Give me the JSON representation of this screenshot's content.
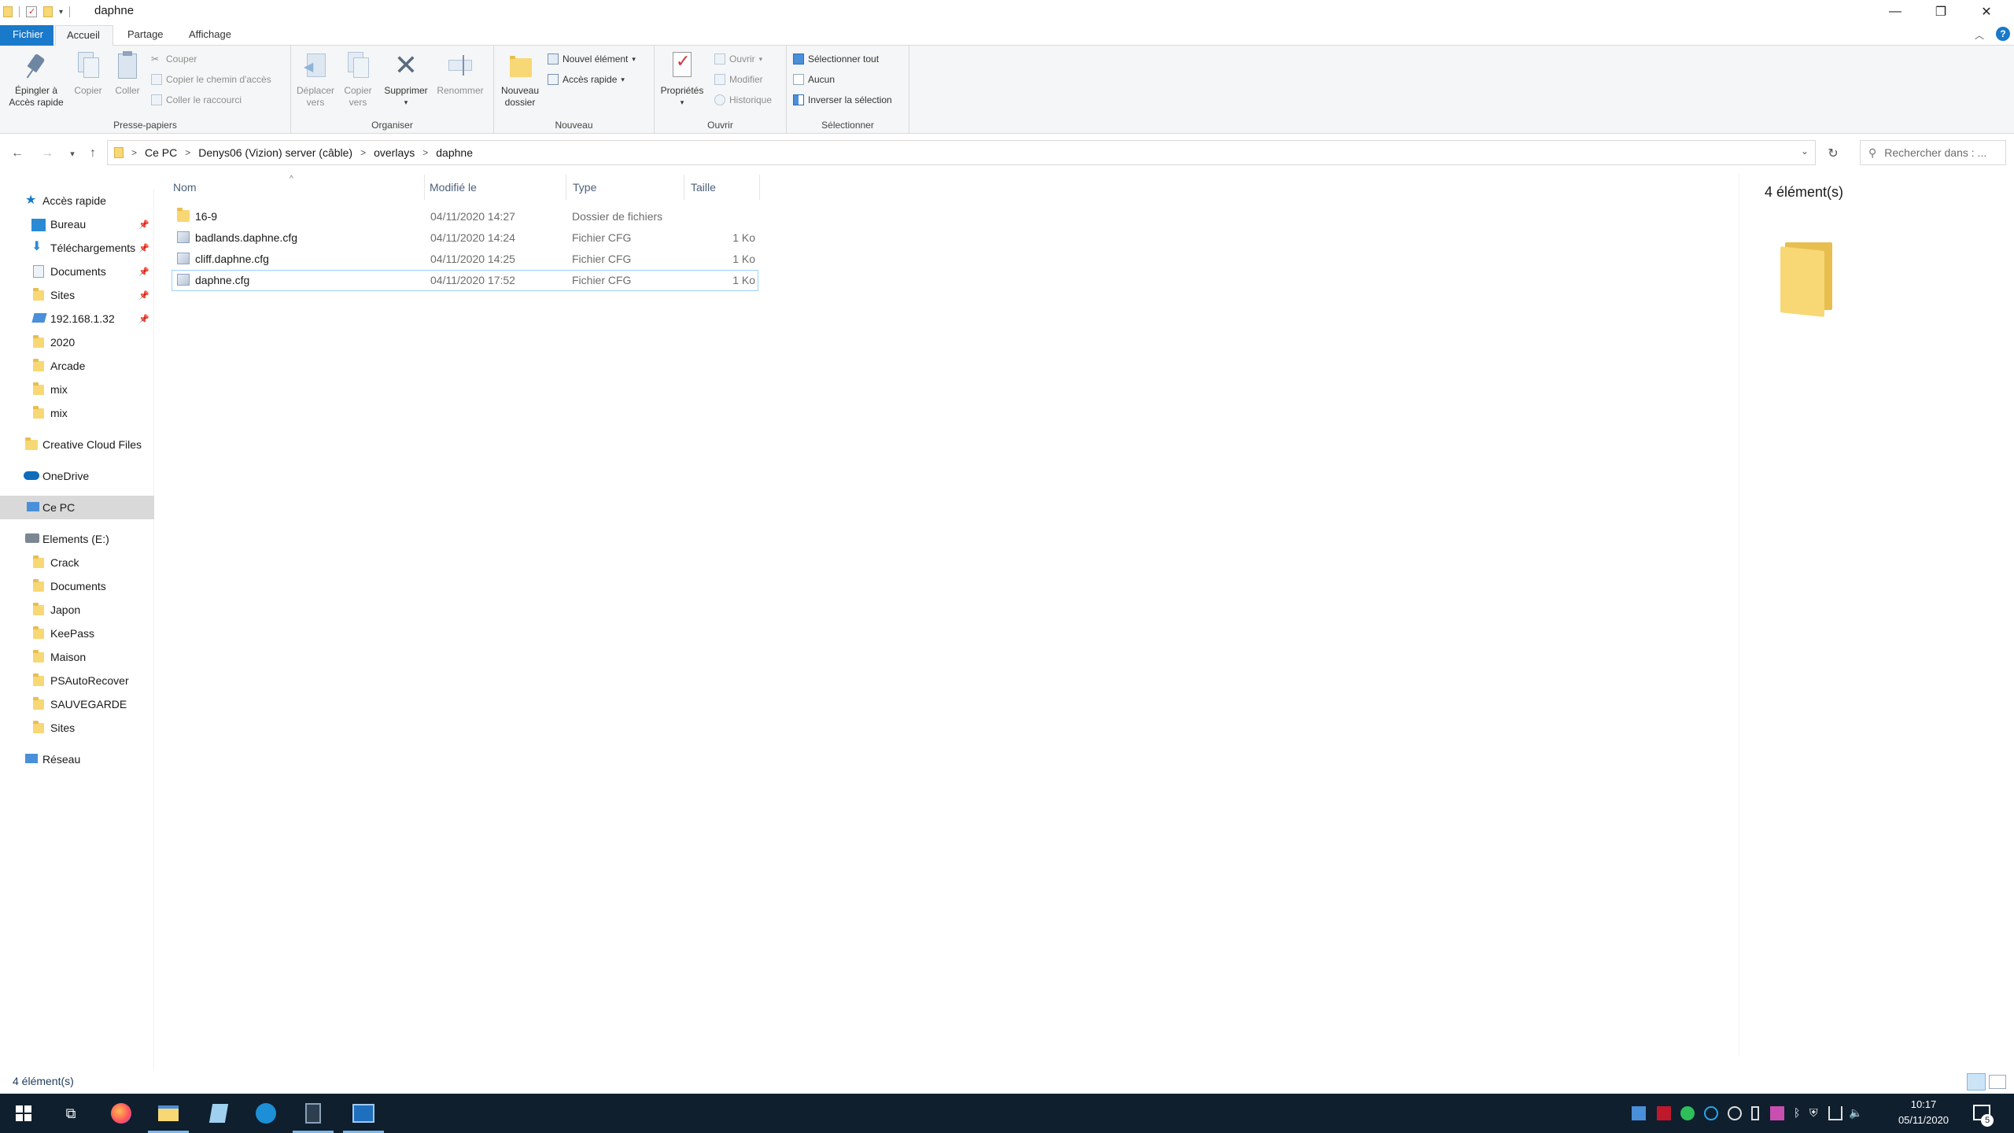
{
  "window": {
    "title": "daphne",
    "controls": {
      "minimize": "—",
      "maximize": "❐",
      "close": "✕"
    }
  },
  "ribbon_tabs": [
    "Fichier",
    "Accueil",
    "Partage",
    "Affichage"
  ],
  "ribbon": {
    "presse_papiers": {
      "label": "Presse-papiers",
      "pin_line1": "Épingler à",
      "pin_line2": "Accès rapide",
      "copier": "Copier",
      "coller": "Coller",
      "couper": "Couper",
      "copier_chemin": "Copier le chemin d'accès",
      "coller_raccourci": "Coller le raccourci"
    },
    "organiser": {
      "label": "Organiser",
      "deplacer_line1": "Déplacer",
      "deplacer_line2": "vers",
      "copier_line1": "Copier",
      "copier_line2": "vers",
      "supprimer": "Supprimer",
      "renommer": "Renommer"
    },
    "nouveau": {
      "label": "Nouveau",
      "nouveau_dossier_line1": "Nouveau",
      "nouveau_dossier_line2": "dossier",
      "nouvel_element": "Nouvel élément",
      "acces_rapide": "Accès rapide"
    },
    "ouvrir": {
      "label": "Ouvrir",
      "proprietes": "Propriétés",
      "ouvrir": "Ouvrir",
      "modifier": "Modifier",
      "historique": "Historique"
    },
    "selectionner": {
      "label": "Sélectionner",
      "tout": "Sélectionner tout",
      "aucun": "Aucun",
      "inverser": "Inverser la sélection"
    }
  },
  "address": {
    "crumbs": [
      "Ce PC",
      "Denys06 (Vizion) server (câble)",
      "overlays",
      "daphne"
    ],
    "search_placeholder": "Rechercher dans : ..."
  },
  "sidebar": {
    "quick_access": "Accès rapide",
    "quick_items": [
      "Bureau",
      "Téléchargements",
      "Documents",
      "Sites",
      "192.168.1.32",
      "2020",
      "Arcade",
      "mix",
      "mix"
    ],
    "creative_cloud": "Creative Cloud Files",
    "onedrive": "OneDrive",
    "this_pc": "Ce PC",
    "drive": "Elements (E:)",
    "drive_items": [
      "Crack",
      "Documents",
      "Japon",
      "KeePass",
      "Maison",
      "PSAutoRecover",
      "SAUVEGARDE",
      "Sites"
    ],
    "network": "Réseau"
  },
  "columns": [
    "Nom",
    "Modifié le",
    "Type",
    "Taille"
  ],
  "files": [
    {
      "name": "16-9",
      "modified": "04/11/2020 14:27",
      "type": "Dossier de fichiers",
      "size": ""
    },
    {
      "name": "badlands.daphne.cfg",
      "modified": "04/11/2020 14:24",
      "type": "Fichier CFG",
      "size": "1 Ko"
    },
    {
      "name": "cliff.daphne.cfg",
      "modified": "04/11/2020 14:25",
      "type": "Fichier CFG",
      "size": "1 Ko"
    },
    {
      "name": "daphne.cfg",
      "modified": "04/11/2020 17:52",
      "type": "Fichier CFG",
      "size": "1 Ko"
    }
  ],
  "preview": {
    "count": "4 élément(s)"
  },
  "status": {
    "count": "4 élément(s)"
  },
  "taskbar": {
    "time": "10:17",
    "date": "05/11/2020",
    "notification_count": "5"
  },
  "colors": {
    "accent": "#1979ca",
    "folder": "#f8d775",
    "selected_nav": "#d9d9d9",
    "taskbar": "#0f1f2e"
  }
}
